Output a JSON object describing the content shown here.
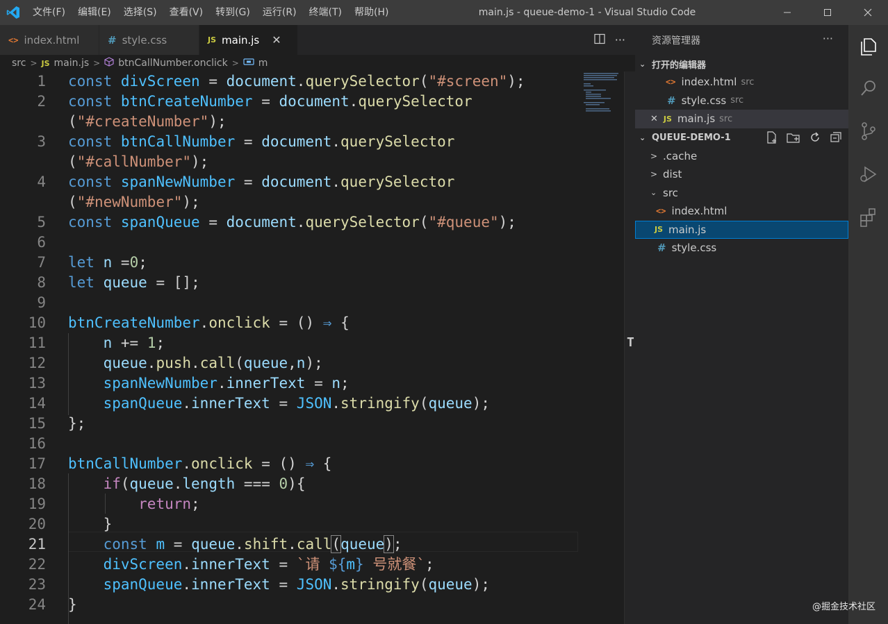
{
  "window": {
    "title": "main.js - queue-demo-1 - Visual Studio Code",
    "menu": [
      "文件(F)",
      "编辑(E)",
      "选择(S)",
      "查看(V)",
      "转到(G)",
      "运行(R)",
      "终端(T)",
      "帮助(H)"
    ]
  },
  "tabs": [
    {
      "label": "index.html",
      "icon": "html-icon"
    },
    {
      "label": "style.css",
      "icon": "css-icon"
    },
    {
      "label": "main.js",
      "icon": "js-icon",
      "active": true
    }
  ],
  "icons": {
    "html": "<>",
    "css": "#",
    "js": "JS",
    "close": "✕",
    "more": "···"
  },
  "breadcrumb": [
    "src",
    "main.js",
    "btnCallNumber.onclick",
    "m"
  ],
  "editor": {
    "current_line": 21,
    "line_numbers": [
      "1",
      "2",
      "",
      "3",
      "",
      "4",
      "",
      "5",
      "6",
      "7",
      "8",
      "9",
      "10",
      "11",
      "12",
      "13",
      "14",
      "15",
      "16",
      "17",
      "18",
      "19",
      "20",
      "21",
      "22",
      "23",
      "24"
    ]
  },
  "sidebar": {
    "title": "资源管理器",
    "open_editors_header": "打开的编辑器",
    "open_editors": [
      {
        "name": "index.html",
        "dir": "src"
      },
      {
        "name": "style.css",
        "dir": "src"
      },
      {
        "name": "main.js",
        "dir": "src"
      }
    ],
    "project_header": "QUEUE-DEMO-1",
    "tree": [
      {
        "name": ".cache",
        "type": "folder"
      },
      {
        "name": "dist",
        "type": "folder"
      },
      {
        "name": "src",
        "type": "folder-open"
      },
      {
        "name": "index.html",
        "type": "html"
      },
      {
        "name": "main.js",
        "type": "js"
      },
      {
        "name": "style.css",
        "type": "css"
      }
    ]
  },
  "watermark": "@掘金技术社区",
  "colors": {
    "keyword": "#569cd6",
    "variable": "#9cdcfe",
    "function": "#dcdcaa",
    "string": "#ce9178",
    "number": "#b5cea8",
    "control": "#c586c0",
    "selection": "#094771"
  }
}
